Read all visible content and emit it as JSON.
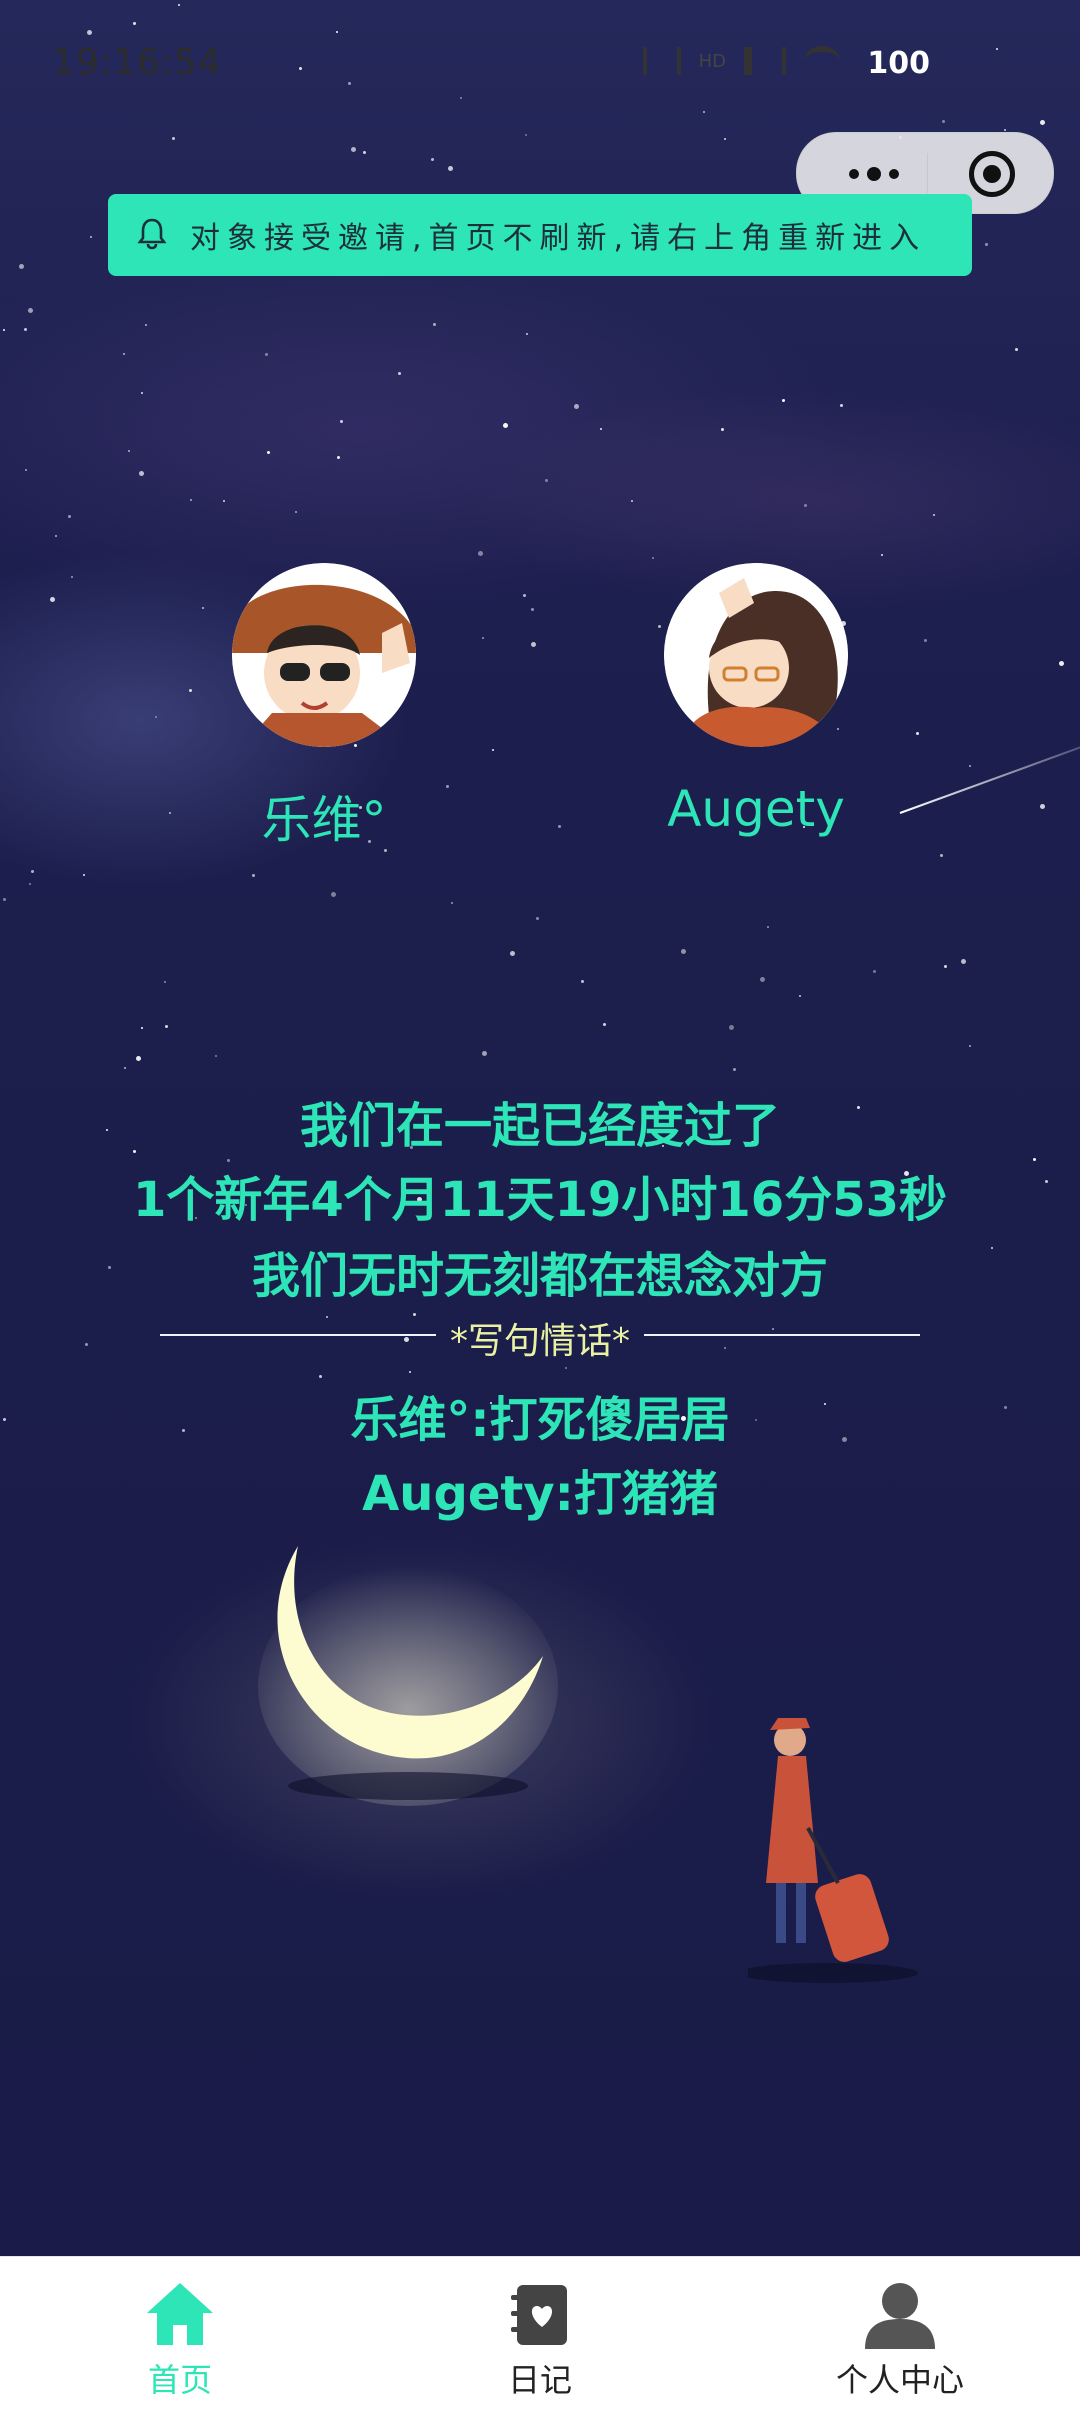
{
  "status_bar": {
    "time": "19:16:54",
    "battery": "100"
  },
  "capsule": {
    "more_icon": "more-dots-icon",
    "close_icon": "target-icon"
  },
  "notice": {
    "icon": "bell-icon",
    "text": "对象接受邀请,首页不刷新,请右上角重新进入"
  },
  "couple": {
    "left_name": "乐维°",
    "right_name": "Augety"
  },
  "message": {
    "line1": "我们在一起已经度过了",
    "line2": "1个新年4个月11天19小时16分53秒",
    "line3": "我们无时无刻都在想念对方",
    "divider_label": "*写句情话*",
    "quote1": "乐维°:打死傻居居",
    "quote2": "Augety:打猪猪"
  },
  "tabbar": {
    "items": [
      {
        "label": "首页",
        "icon": "home-icon",
        "active": true
      },
      {
        "label": "日记",
        "icon": "diary-icon",
        "active": false
      },
      {
        "label": "个人中心",
        "icon": "user-icon",
        "active": false
      }
    ],
    "active_color": "#2de5b6",
    "inactive_color": "#222222"
  },
  "colors": {
    "accent": "#2de5b6",
    "background": "#1a1b4a",
    "divider_label": "#e8f2a2"
  }
}
